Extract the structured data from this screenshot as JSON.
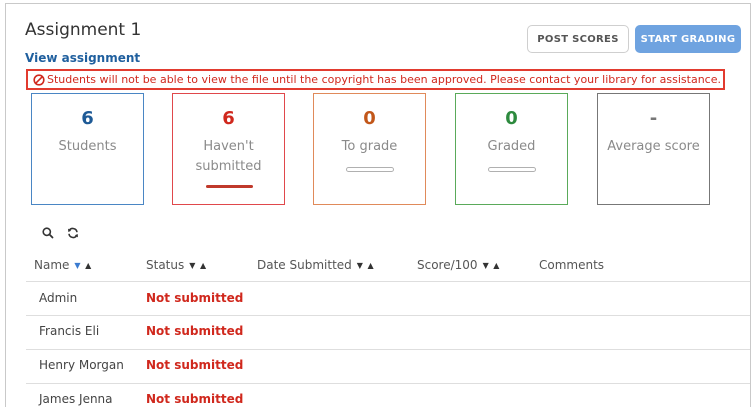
{
  "assignment": {
    "title": "Assignment 1",
    "view_link": "View assignment"
  },
  "buttons": {
    "post_scores": "POST SCORES",
    "start_grading": "START GRADING"
  },
  "alert": {
    "icon": "prohibited-icon",
    "text": "Students will not be able to view the file until the copyright has been approved. Please contact your library for assistance."
  },
  "stats": {
    "students": {
      "value": "6",
      "label": "Students"
    },
    "not_submitted": {
      "value": "6",
      "label_line1": "Haven't",
      "label_line2": "submitted"
    },
    "to_grade": {
      "value": "0",
      "label": "To grade"
    },
    "graded": {
      "value": "0",
      "label": "Graded"
    },
    "average": {
      "value": "-",
      "label": "Average score"
    }
  },
  "toolbar": {
    "search_icon": "search-icon",
    "refresh_icon": "refresh-icon"
  },
  "table": {
    "headers": {
      "name": "Name",
      "status": "Status",
      "date_submitted": "Date Submitted",
      "score": "Score/100",
      "comments": "Comments"
    },
    "rows": [
      {
        "name": "Admin",
        "status": "Not submitted"
      },
      {
        "name": "Francis Eli",
        "status": "Not submitted"
      },
      {
        "name": "Henry Morgan",
        "status": "Not submitted"
      },
      {
        "name": "James Jenna",
        "status": "Not submitted"
      }
    ]
  },
  "colors": {
    "accent_blue": "#6fa3e0",
    "link_blue": "#1f5f9e",
    "alert_red": "#d0281d",
    "orange": "#c2571a",
    "green": "#2d8a3e"
  }
}
